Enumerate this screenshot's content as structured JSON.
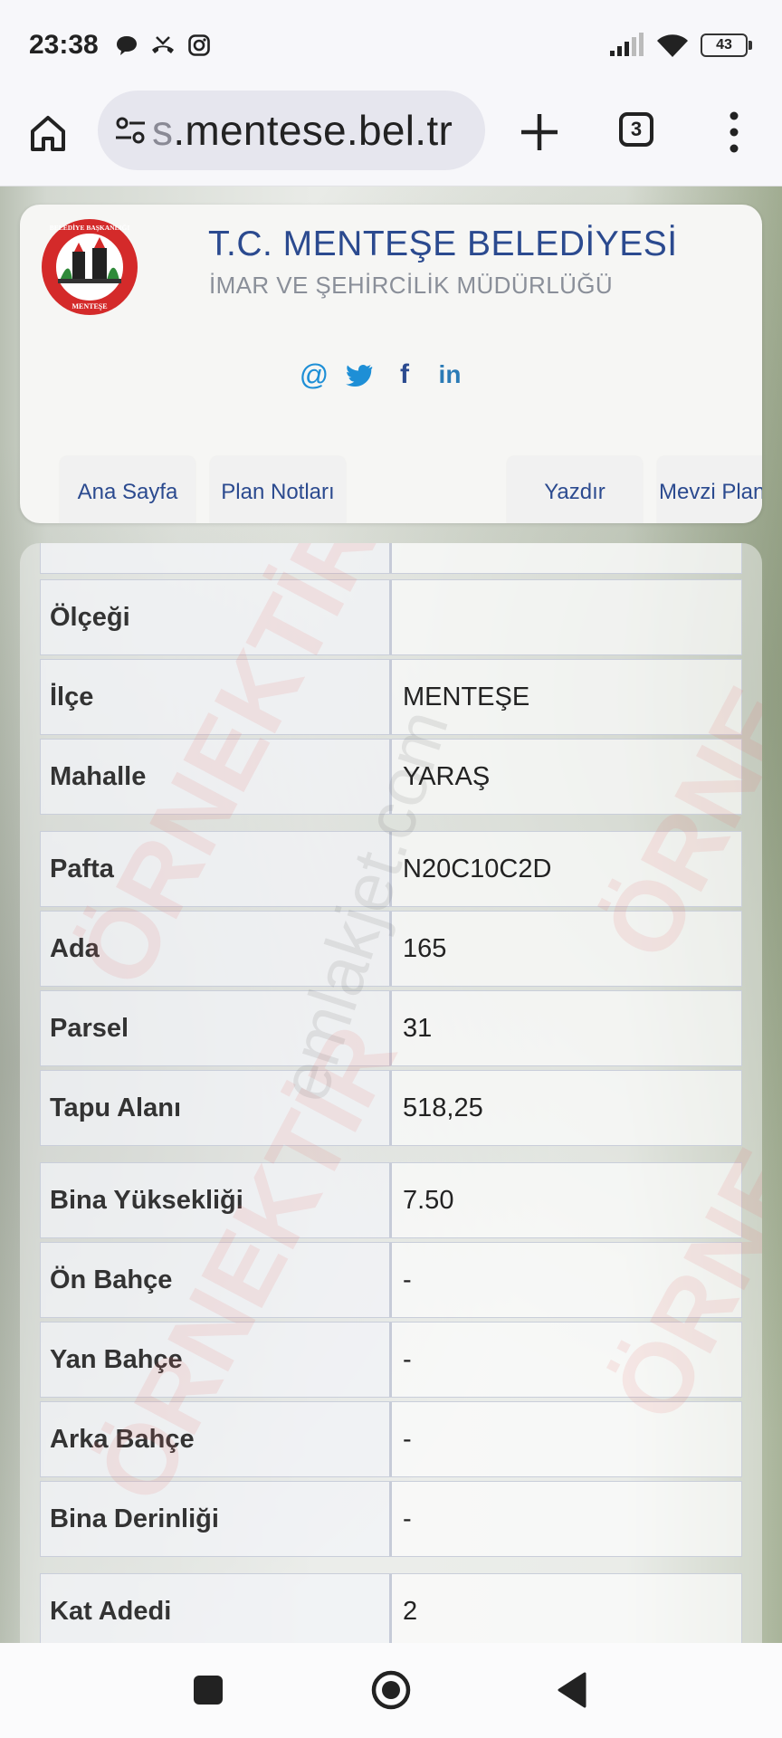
{
  "status_bar": {
    "time": "23:38",
    "battery": "43",
    "icons": [
      "message-icon",
      "missed-call-icon",
      "instagram-icon",
      "signal-icon",
      "wifi-icon",
      "battery-icon"
    ]
  },
  "browser": {
    "url_hidden_part": "s",
    "url_visible": ".mentese.bel.tr",
    "tab_count": "3"
  },
  "header": {
    "title": "T.C. MENTEŞE BELEDİYESİ",
    "subtitle": "İMAR VE ŞEHİRCİLİK MÜDÜRLÜĞÜ",
    "logo_text_top": "BELEDİYE BAŞKANLIĞI",
    "logo_text_bottom": "MENTEŞE",
    "social": [
      {
        "name": "email-icon",
        "glyph": "@"
      },
      {
        "name": "twitter-icon",
        "glyph": ""
      },
      {
        "name": "facebook-icon",
        "glyph": "f"
      },
      {
        "name": "linkedin-icon",
        "glyph": "in"
      }
    ],
    "nav": [
      {
        "label": "Ana Sayfa"
      },
      {
        "label": "Plan Notları"
      },
      {
        "label": "Yazdır"
      },
      {
        "label": "Mevzi Plan Not"
      }
    ]
  },
  "table": {
    "rows": [
      {
        "label": "Ölçeği",
        "value": ""
      },
      {
        "label": "İlçe",
        "value": "MENTEŞE"
      },
      {
        "label": "Mahalle",
        "value": "YARAŞ"
      },
      {
        "label": "Pafta",
        "value": "N20C10C2D"
      },
      {
        "label": "Ada",
        "value": "165"
      },
      {
        "label": "Parsel",
        "value": "31"
      },
      {
        "label": "Tapu Alanı",
        "value": "518,25"
      },
      {
        "label": "Bina Yüksekliği",
        "value": "7.50"
      },
      {
        "label": "Ön Bahçe",
        "value": "-"
      },
      {
        "label": "Yan Bahçe",
        "value": "-"
      },
      {
        "label": "Arka Bahçe",
        "value": "-"
      },
      {
        "label": "Bina Derinliği",
        "value": "-"
      },
      {
        "label": "Kat Adedi",
        "value": "2"
      }
    ]
  },
  "watermarks": {
    "ornek": "ÖRNEKTİR",
    "ornek_partial": "ÖRNE",
    "site": "emlakjet.com"
  },
  "colors": {
    "accent": "#2b4a8f",
    "social": "#1e8fd6",
    "watermark": "#e8a3a3"
  }
}
